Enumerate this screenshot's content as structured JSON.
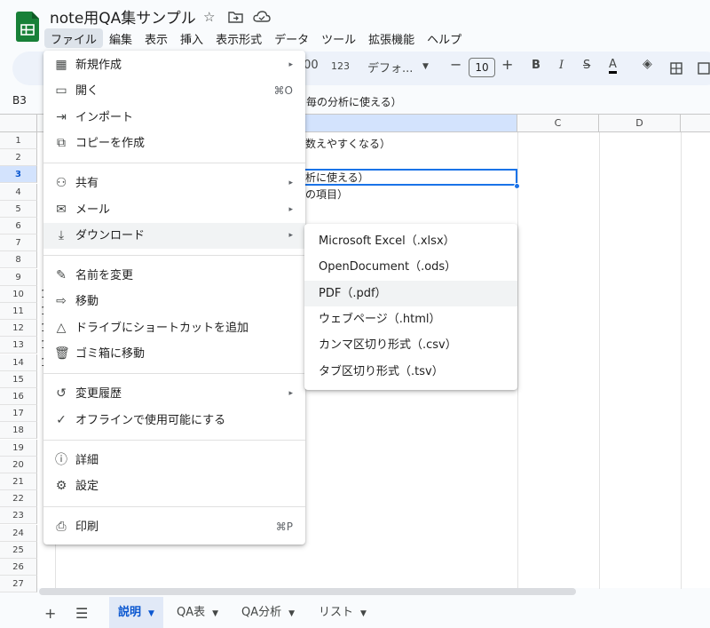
{
  "app": {
    "title": "note用QA集サンプル",
    "title_icons": [
      "star-icon",
      "folder-move-icon",
      "cloud-icon"
    ]
  },
  "menubar": [
    "ファイル",
    "編集",
    "表示",
    "挿入",
    "表示形式",
    "データ",
    "ツール",
    "拡張機能",
    "ヘルプ"
  ],
  "toolbar": {
    "decimal": ".00",
    "number_format": "123",
    "font": "デフォ...",
    "font_size": "10",
    "bold": "B",
    "italic": "I",
    "strike": "S",
    "text_color": "A"
  },
  "formula_bar": {
    "cell_ref": "B3",
    "value": "毎の分析に使える）"
  },
  "grid": {
    "columns": [
      "C",
      "D"
    ],
    "rows": [
      "1",
      "2",
      "3",
      "4",
      "5",
      "6",
      "7",
      "8",
      "9",
      "10",
      "11",
      "12",
      "13",
      "14",
      "15",
      "16",
      "17",
      "18",
      "19",
      "20",
      "21",
      "22",
      "23",
      "24",
      "25",
      "26",
      "27"
    ],
    "row_prefixes": {
      "10": "1",
      "11": "1",
      "12": "1",
      "13": "1",
      "14": "1"
    },
    "cells": {
      "r1": "数えやすくなる）",
      "r3": "析に使える）",
      "r4": "の項目）"
    }
  },
  "file_menu": {
    "groups": [
      [
        {
          "icon": "new-icon",
          "glyph": "▦",
          "label": "新規作成",
          "arrow": "▸"
        },
        {
          "icon": "folder-open-icon",
          "glyph": "▭",
          "label": "開く",
          "shortcut": "⌘O"
        },
        {
          "icon": "import-icon",
          "glyph": "⇥",
          "label": "インポート"
        },
        {
          "icon": "copy-icon",
          "glyph": "⧉",
          "label": "コピーを作成"
        }
      ],
      [
        {
          "icon": "share-icon",
          "glyph": "⚇",
          "label": "共有",
          "arrow": "▸"
        },
        {
          "icon": "mail-icon",
          "glyph": "✉",
          "label": "メール",
          "arrow": "▸"
        },
        {
          "icon": "download-icon",
          "glyph": "⤓",
          "label": "ダウンロード",
          "arrow": "▸",
          "highlight": true
        }
      ],
      [
        {
          "icon": "rename-icon",
          "glyph": "✎",
          "label": "名前を変更"
        },
        {
          "icon": "move-icon",
          "glyph": "⇨",
          "label": "移動"
        },
        {
          "icon": "drive-shortcut-icon",
          "glyph": "△",
          "label": "ドライブにショートカットを追加"
        },
        {
          "icon": "trash-icon",
          "glyph": "🗑",
          "label": "ゴミ箱に移動"
        }
      ],
      [
        {
          "icon": "history-icon",
          "glyph": "↺",
          "label": "変更履歴",
          "arrow": "▸"
        },
        {
          "icon": "offline-icon",
          "glyph": "✓",
          "label": "オフラインで使用可能にする"
        }
      ],
      [
        {
          "icon": "info-icon",
          "glyph": "ⓘ",
          "label": "詳細"
        },
        {
          "icon": "settings-icon",
          "glyph": "⚙",
          "label": "設定"
        }
      ],
      [
        {
          "icon": "print-icon",
          "glyph": "⎙",
          "label": "印刷",
          "shortcut": "⌘P"
        }
      ]
    ]
  },
  "download_submenu": [
    {
      "label": "Microsoft Excel（.xlsx）"
    },
    {
      "label": "OpenDocument（.ods）"
    },
    {
      "label": "PDF（.pdf）",
      "highlight": true
    },
    {
      "label": "ウェブページ（.html）"
    },
    {
      "label": "カンマ区切り形式（.csv）"
    },
    {
      "label": "タブ区切り形式（.tsv）"
    }
  ],
  "sheet_tabs": [
    {
      "label": "説明",
      "active": true
    },
    {
      "label": "QA表"
    },
    {
      "label": "QA分析"
    },
    {
      "label": "リスト"
    }
  ],
  "colors": {
    "accent": "#0b57d0",
    "selection": "#1a73e8",
    "logo_green": "#188038"
  }
}
